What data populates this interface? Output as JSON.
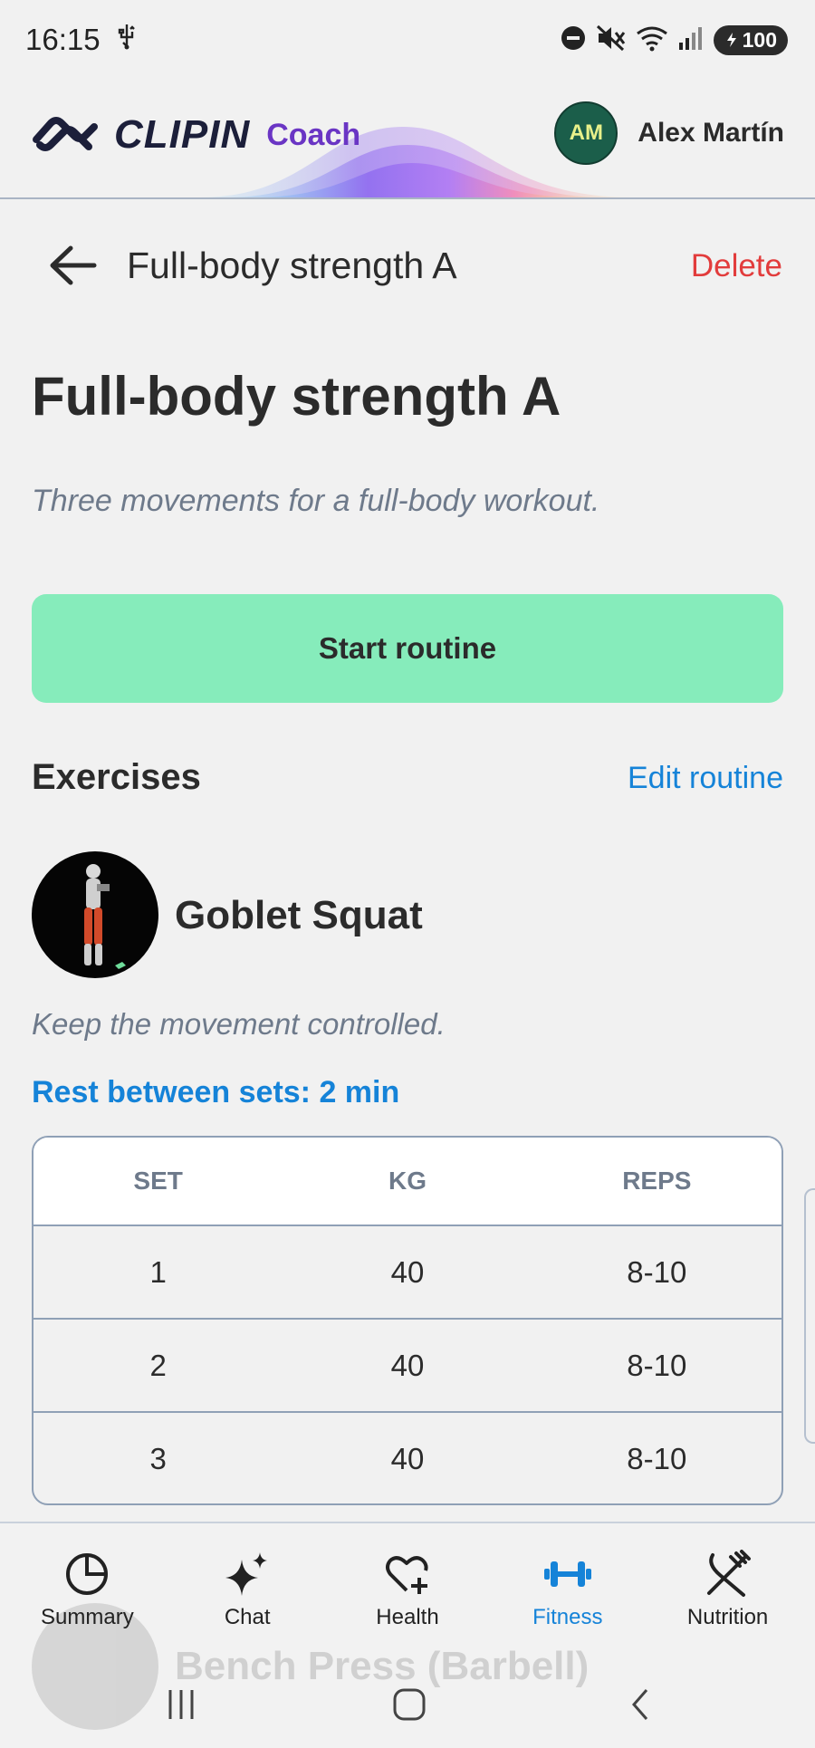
{
  "status_bar": {
    "time": "16:15",
    "battery": "100",
    "icons": [
      "usb-icon",
      "dnd-icon",
      "mute-icon",
      "wifi-icon",
      "signal-icon",
      "battery-icon"
    ]
  },
  "header": {
    "logo_text": "CLIPIN",
    "logo_sub": "Coach",
    "avatar_initials": "AM",
    "user_name": "Alex Martín"
  },
  "subheader": {
    "title": "Full-body strength A",
    "delete_label": "Delete"
  },
  "routine": {
    "title": "Full-body strength A",
    "description": "Three movements for a full-body workout.",
    "start_label": "Start routine"
  },
  "exercises": {
    "heading": "Exercises",
    "edit_label": "Edit routine",
    "items": [
      {
        "name": "Goblet Squat",
        "note": "Keep the movement controlled.",
        "rest": "Rest between sets: 2 min",
        "columns": [
          "SET",
          "KG",
          "REPS"
        ],
        "sets": [
          [
            "1",
            "40",
            "8-10"
          ],
          [
            "2",
            "40",
            "8-10"
          ],
          [
            "3",
            "40",
            "8-10"
          ]
        ]
      },
      {
        "name": "Bench Press (Barbell)"
      }
    ]
  },
  "nav": {
    "items": [
      {
        "label": "Summary",
        "icon": "pie-chart-icon"
      },
      {
        "label": "Chat",
        "icon": "sparkle-icon"
      },
      {
        "label": "Health",
        "icon": "heart-plus-icon"
      },
      {
        "label": "Fitness",
        "icon": "dumbbell-icon",
        "active": true
      },
      {
        "label": "Nutrition",
        "icon": "fork-knife-icon"
      }
    ],
    "active_color": "#1583d8"
  },
  "colors": {
    "accent_green": "#86ecbb",
    "link_blue": "#1583d8",
    "delete_red": "#e23c3c",
    "brand_purple": "#6a35c4"
  }
}
